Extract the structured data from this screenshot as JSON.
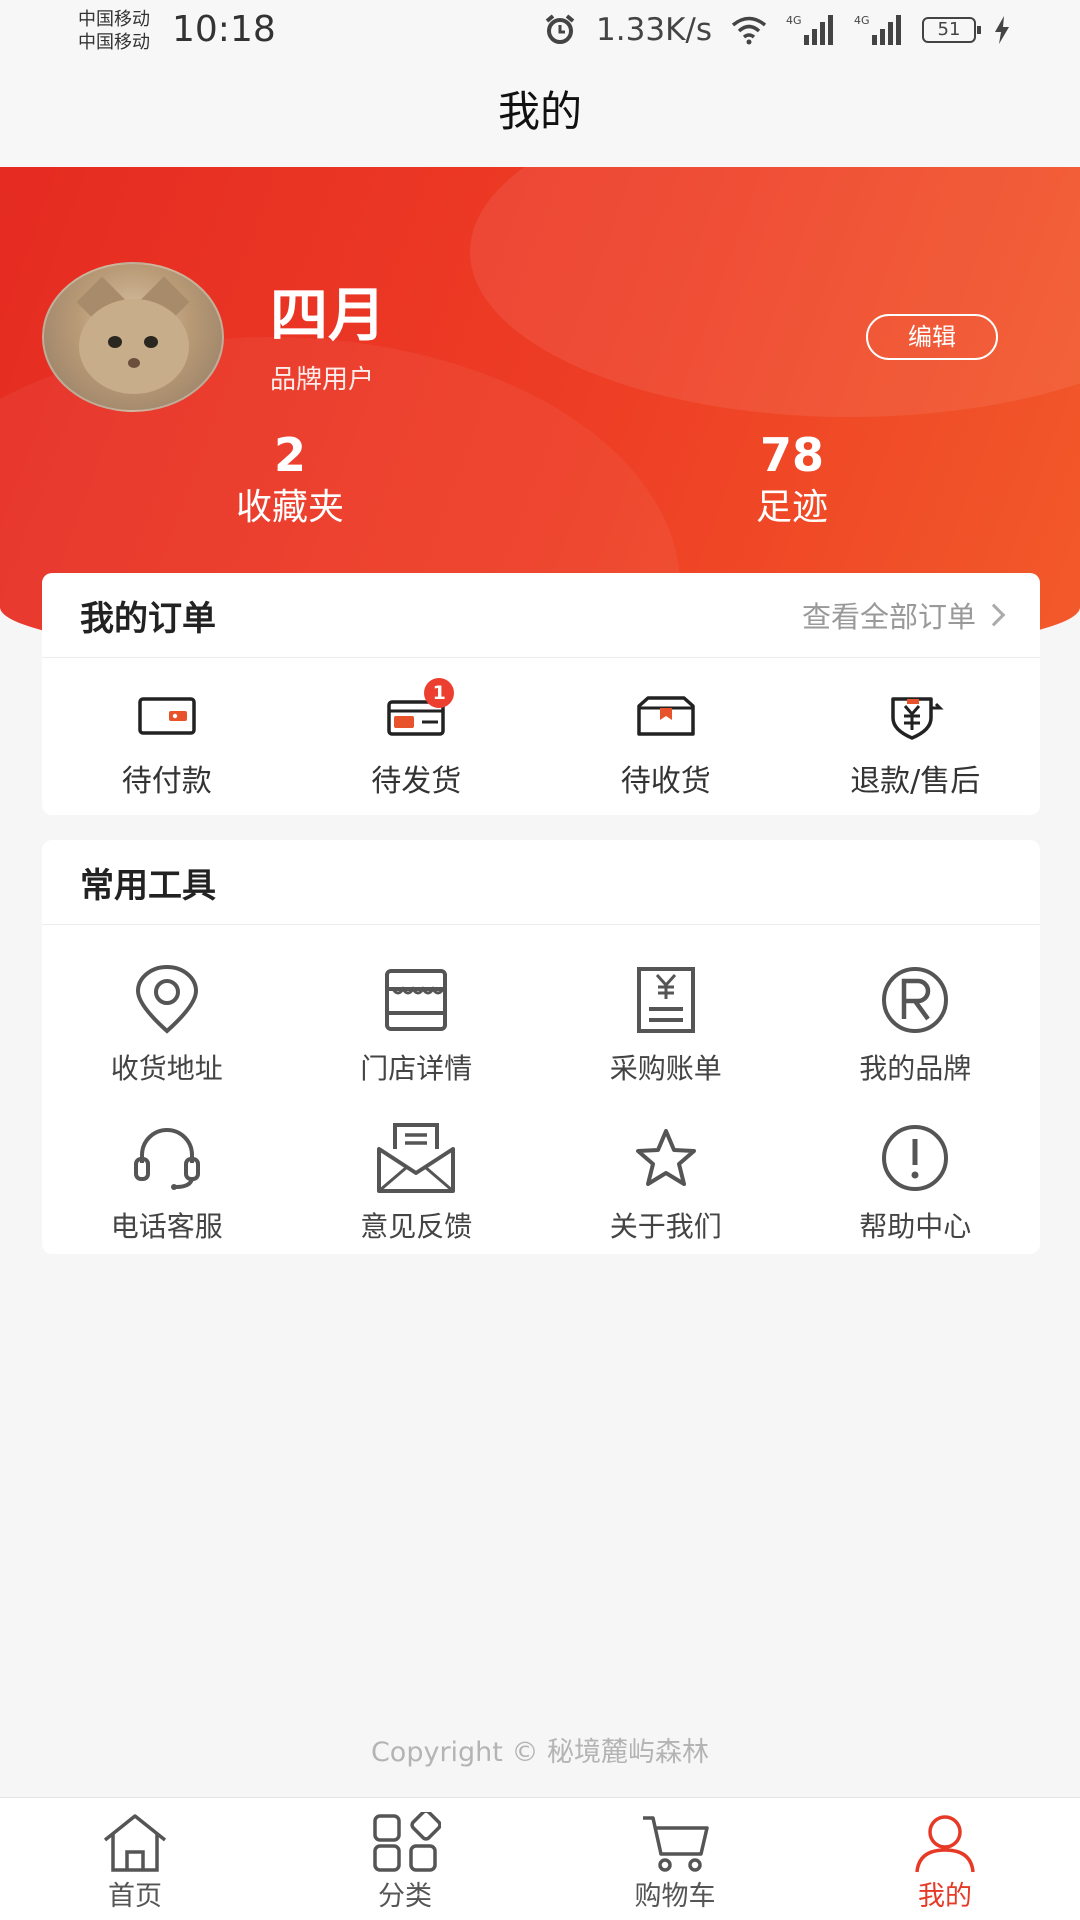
{
  "status_bar": {
    "carrier_1": "中国移动",
    "carrier_2": "中国移动",
    "time": "10:18",
    "net_speed": "1.33K/s",
    "network_1": "4G",
    "network_2": "4G",
    "battery": "51"
  },
  "nav": {
    "title": "我的"
  },
  "profile": {
    "name": "四月",
    "role": "品牌用户",
    "edit_label": "编辑",
    "stats": [
      {
        "value": "2",
        "label": "收藏夹"
      },
      {
        "value": "78",
        "label": "足迹"
      }
    ]
  },
  "orders": {
    "title": "我的订单",
    "view_all": "查看全部订单",
    "items": [
      {
        "label": "待付款",
        "icon": "wallet-icon"
      },
      {
        "label": "待发货",
        "icon": "card-icon",
        "badge": "1"
      },
      {
        "label": "待收货",
        "icon": "box-icon"
      },
      {
        "label": "退款/售后",
        "icon": "refund-icon"
      }
    ]
  },
  "tools": {
    "title": "常用工具",
    "items": [
      {
        "label": "收货地址",
        "icon": "location-icon"
      },
      {
        "label": "门店详情",
        "icon": "store-icon"
      },
      {
        "label": "采购账单",
        "icon": "bill-icon"
      },
      {
        "label": "我的品牌",
        "icon": "registered-icon"
      },
      {
        "label": "电话客服",
        "icon": "headset-icon"
      },
      {
        "label": "意见反馈",
        "icon": "feedback-icon"
      },
      {
        "label": "关于我们",
        "icon": "star-icon"
      },
      {
        "label": "帮助中心",
        "icon": "help-icon"
      }
    ]
  },
  "copyright": "Copyright © 秘境麓屿森林",
  "tabs": [
    {
      "label": "首页",
      "icon": "home-icon"
    },
    {
      "label": "分类",
      "icon": "category-icon"
    },
    {
      "label": "购物车",
      "icon": "cart-icon"
    },
    {
      "label": "我的",
      "icon": "profile-icon",
      "active": true
    }
  ],
  "colors": {
    "accent": "#e63a27",
    "header_start": "#e52b22",
    "header_end": "#f25a2a"
  }
}
